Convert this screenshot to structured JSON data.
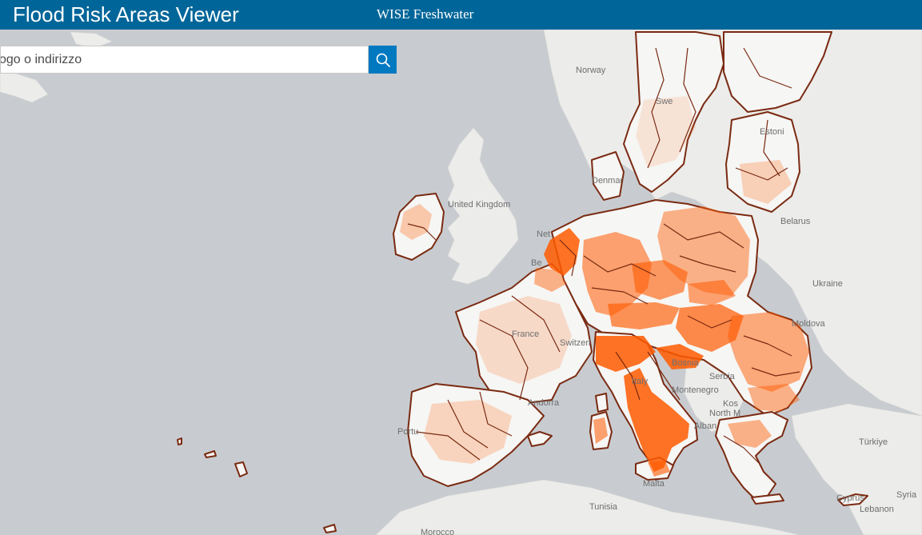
{
  "header": {
    "title": "Flood Risk Areas Viewer",
    "subtitle": "WISE Freshwater"
  },
  "search": {
    "placeholder": "ogo o indirizzo",
    "button_icon": "search-icon"
  },
  "map": {
    "labels": {
      "norway": "Norway",
      "estonia": "Estoni",
      "denmark": "Denmar",
      "united_kingdom": "United Kingdom",
      "belarus": "Belarus",
      "ukraine": "Ukraine",
      "moldova": "Moldova",
      "serbia": "Serbia",
      "montenegro": "Montenegro",
      "kosovo": "Kos",
      "north_macedonia": "North M",
      "albania": "Alban",
      "turkiye": "Türkiye",
      "syria": "Syria",
      "lebanon": "Lebanon",
      "tunisia": "Tunisia",
      "morocco": "Morocco",
      "malta": "Malta",
      "france": "France",
      "switzerland": "Switzerl",
      "italy": "Italy",
      "bosnia": "Bosnia",
      "portugal": "Portu",
      "andorra": "Andorra",
      "netherlands": "Net",
      "belgium": "Be",
      "cyprus": "Cyprus",
      "sweden": "Swe"
    },
    "colors": {
      "sea": "#c8ccd0",
      "land": "#f2f2f0",
      "flood_areas": "#ff5a00",
      "boundaries": "#7a2a12"
    }
  }
}
